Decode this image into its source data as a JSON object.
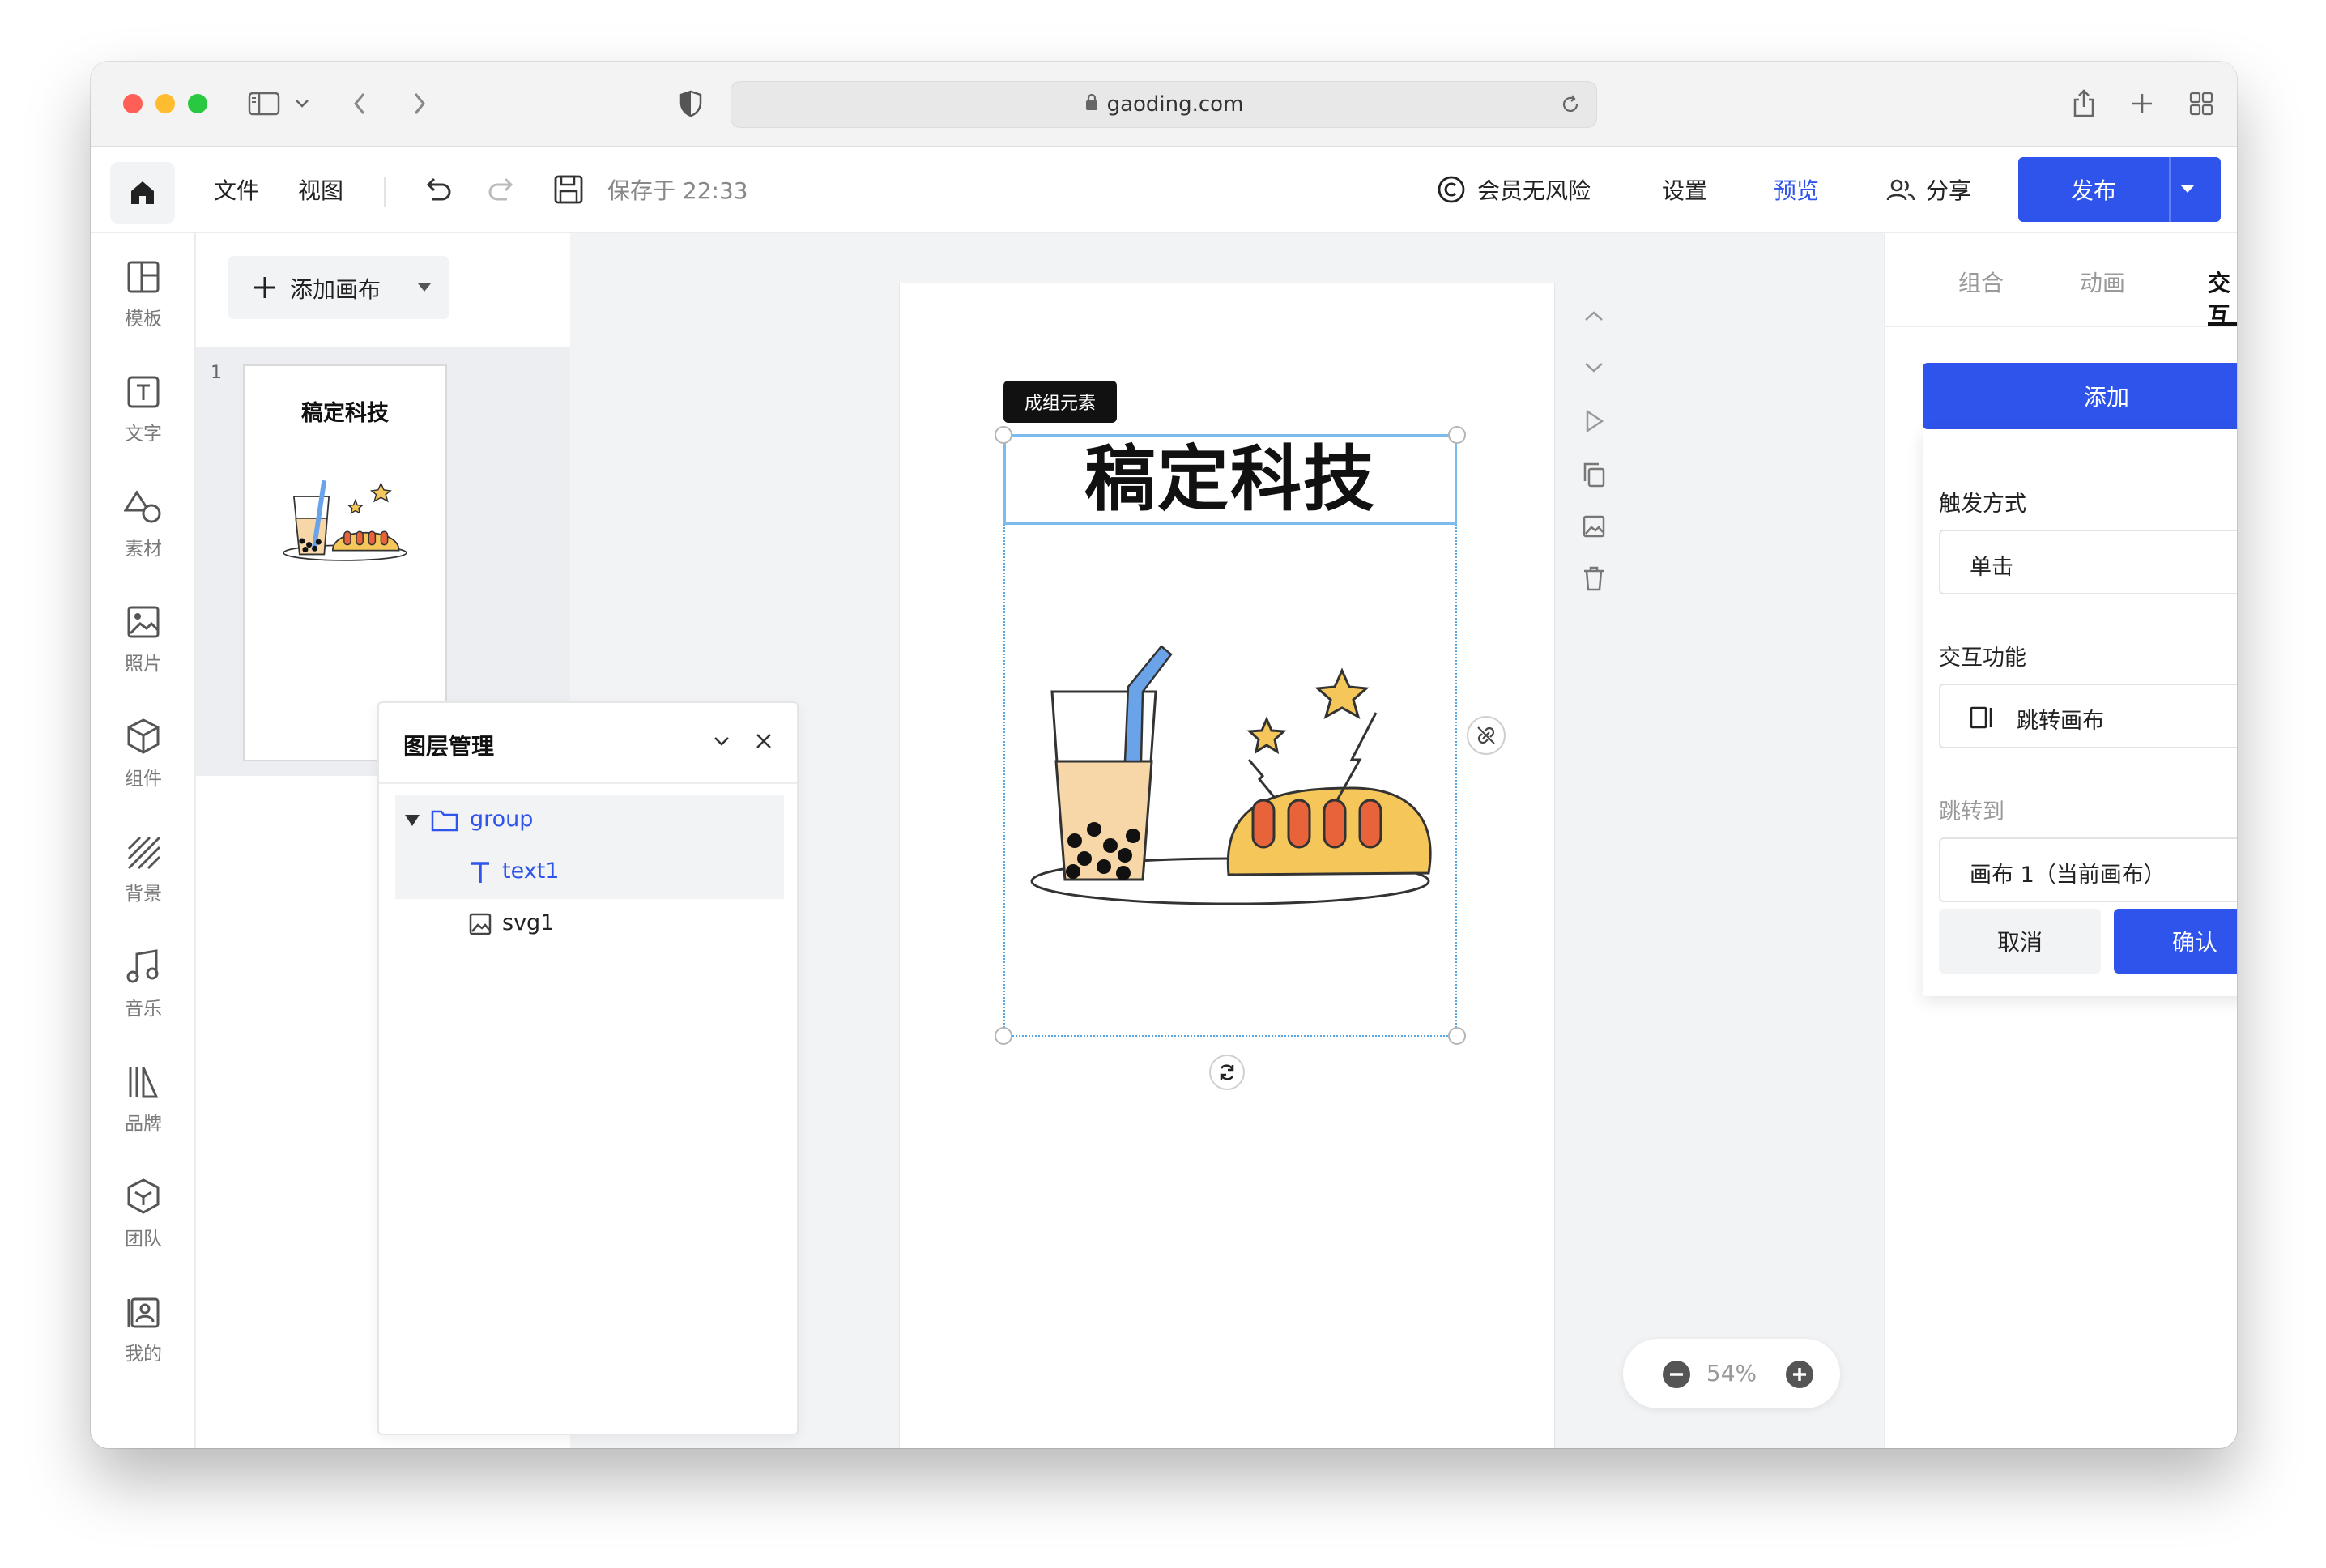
{
  "browser": {
    "url": "gaoding.com"
  },
  "toolbar": {
    "file_label": "文件",
    "view_label": "视图",
    "saved_text": "保存于 22:33",
    "member_label": "会员无风险",
    "settings_label": "设置",
    "preview_label": "预览",
    "share_label": "分享",
    "publish_label": "发布"
  },
  "sidebar": {
    "items": [
      {
        "label": "模板",
        "icon": "template-icon"
      },
      {
        "label": "文字",
        "icon": "text-icon"
      },
      {
        "label": "素材",
        "icon": "shapes-icon"
      },
      {
        "label": "照片",
        "icon": "photo-icon"
      },
      {
        "label": "组件",
        "icon": "cube-icon"
      },
      {
        "label": "背景",
        "icon": "background-icon"
      },
      {
        "label": "音乐",
        "icon": "music-icon"
      },
      {
        "label": "品牌",
        "icon": "brand-icon"
      },
      {
        "label": "团队",
        "icon": "team-icon"
      },
      {
        "label": "我的",
        "icon": "profile-icon"
      }
    ]
  },
  "pages": {
    "add_label": "添加画布",
    "thumbs": [
      {
        "number": "1",
        "title": "稿定科技"
      }
    ]
  },
  "canvas": {
    "group_label": "成组元素",
    "title": "稿定科技",
    "zoom": "54%"
  },
  "layers": {
    "title": "图层管理",
    "items": [
      {
        "name": "group",
        "type": "folder"
      },
      {
        "name": "text1",
        "type": "text"
      },
      {
        "name": "svg1",
        "type": "image"
      }
    ]
  },
  "right_panel": {
    "tabs": [
      "组合",
      "动画",
      "交互"
    ],
    "active_tab": "交互",
    "add_label": "添加",
    "trigger_label": "触发方式",
    "trigger_value": "单击",
    "function_label": "交互功能",
    "function_value": "跳转画布",
    "target_label": "跳转到",
    "target_value": "画布 1（当前画布）",
    "cancel_label": "取消",
    "confirm_label": "确认"
  },
  "colors": {
    "accent": "#2f54eb",
    "selection": "#59a8e6"
  }
}
